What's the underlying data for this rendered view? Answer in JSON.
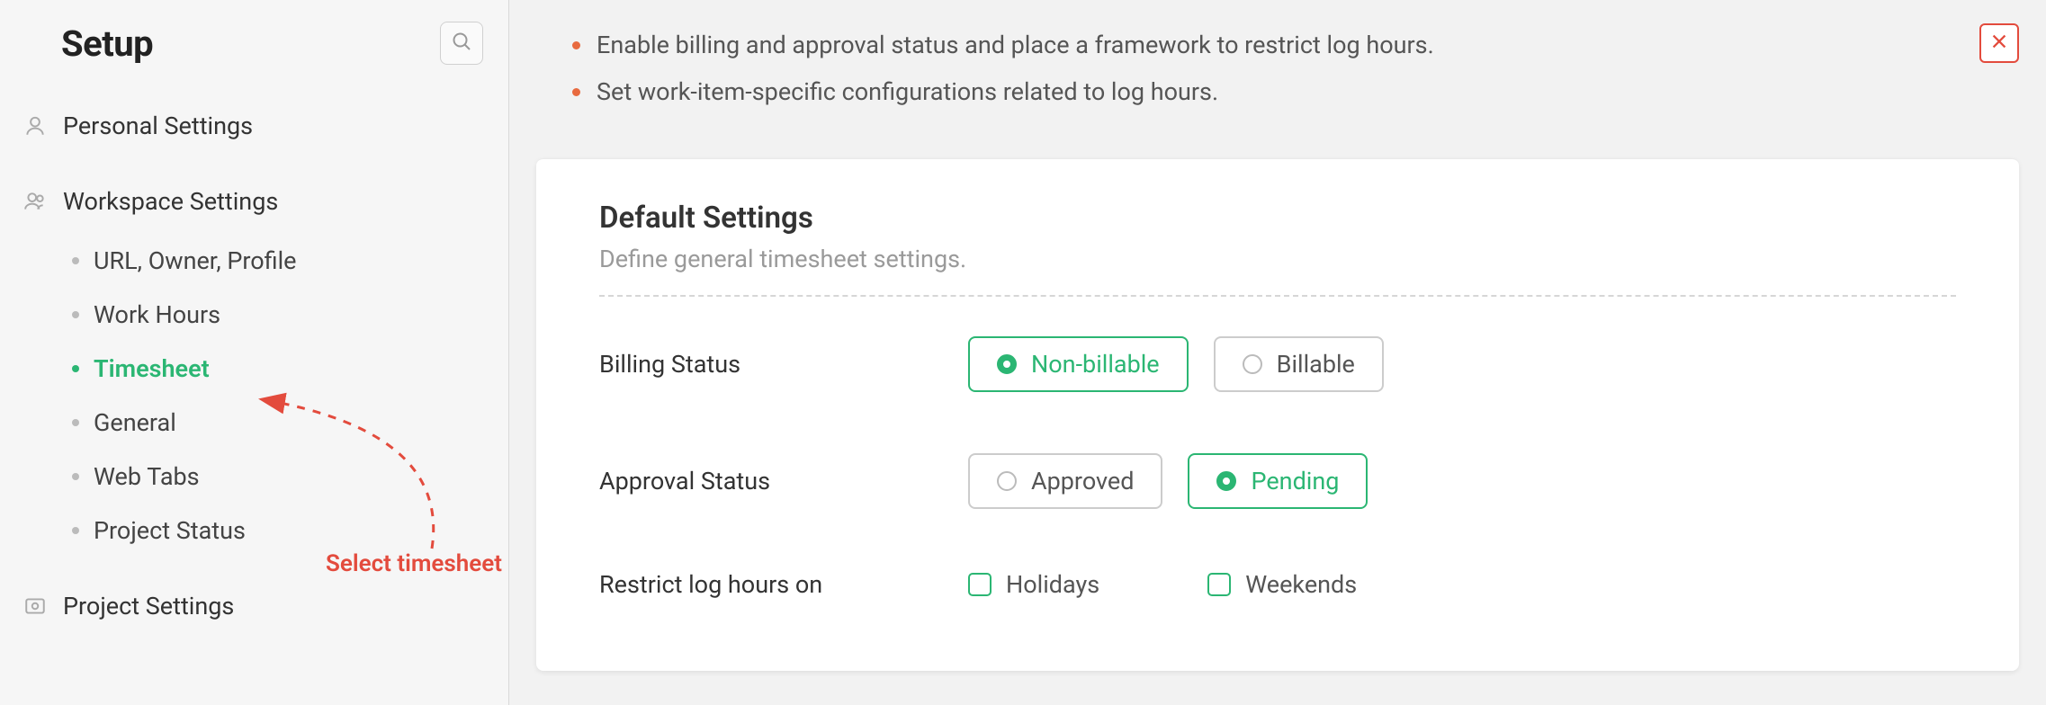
{
  "sidebar": {
    "title": "Setup",
    "sections": [
      {
        "label": "Personal Settings",
        "items": []
      },
      {
        "label": "Workspace Settings",
        "items": [
          {
            "label": "URL, Owner, Profile",
            "active": false
          },
          {
            "label": "Work Hours",
            "active": false
          },
          {
            "label": "Timesheet",
            "active": true
          },
          {
            "label": "General",
            "active": false
          },
          {
            "label": "Web Tabs",
            "active": false
          },
          {
            "label": "Project Status",
            "active": false
          }
        ]
      },
      {
        "label": "Project Settings",
        "items": []
      }
    ]
  },
  "intro": {
    "items": [
      "Enable billing and approval status and place a framework to restrict log hours.",
      "Set work-item-specific configurations related to log hours."
    ]
  },
  "card": {
    "title": "Default Settings",
    "subtitle": "Define general timesheet settings.",
    "rows": {
      "billing": {
        "label": "Billing Status",
        "options": [
          "Non-billable",
          "Billable"
        ],
        "selected": "Non-billable"
      },
      "approval": {
        "label": "Approval Status",
        "options": [
          "Approved",
          "Pending"
        ],
        "selected": "Pending"
      },
      "restrict": {
        "label": "Restrict log hours on",
        "options": [
          "Holidays",
          "Weekends"
        ]
      }
    }
  },
  "annotation": {
    "label": "Select timesheet"
  },
  "colors": {
    "accent_green": "#2bb673",
    "accent_red": "#e34b3d",
    "bullet_orange": "#e86a3f"
  }
}
